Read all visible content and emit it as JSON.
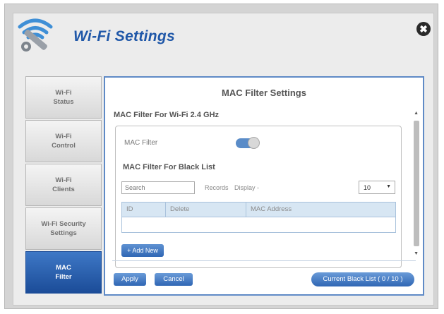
{
  "window": {
    "title": "Wi-Fi Settings",
    "close_symbol": "✖",
    "icon": "wifi-wrench-icon"
  },
  "sidebar": {
    "items": [
      {
        "label": "Wi-Fi\nStatus",
        "active": false
      },
      {
        "label": "Wi-Fi\nControl",
        "active": false
      },
      {
        "label": "Wi-Fi\nClients",
        "active": false
      },
      {
        "label": "Wi-Fi Security\nSettings",
        "active": false
      },
      {
        "label": "MAC\nFilter",
        "active": true
      }
    ]
  },
  "main": {
    "title": "MAC Filter Settings",
    "section_title": "MAC Filter For Wi-Fi 2.4 GHz",
    "mac_filter_label": "MAC Filter",
    "mac_filter_enabled": true,
    "black_list_title": "MAC Filter For Black List",
    "search_placeholder": "Search",
    "records_label": "Records",
    "display_label": "Display -",
    "display_value": "10",
    "table_columns": [
      "ID",
      "Delete",
      "MAC Address"
    ],
    "add_new_label": "+ Add New",
    "scroll_up": "▲",
    "scroll_down": "▼",
    "select_arrow": "▼"
  },
  "footer": {
    "apply_label": "Apply",
    "cancel_label": "Cancel",
    "current_black_list_label": "Current Black List ( 0 / 10 )"
  },
  "colors": {
    "accent": "#1f57a8",
    "active_nav": "#2a5eaa",
    "table_header": "#d7e6f3"
  }
}
